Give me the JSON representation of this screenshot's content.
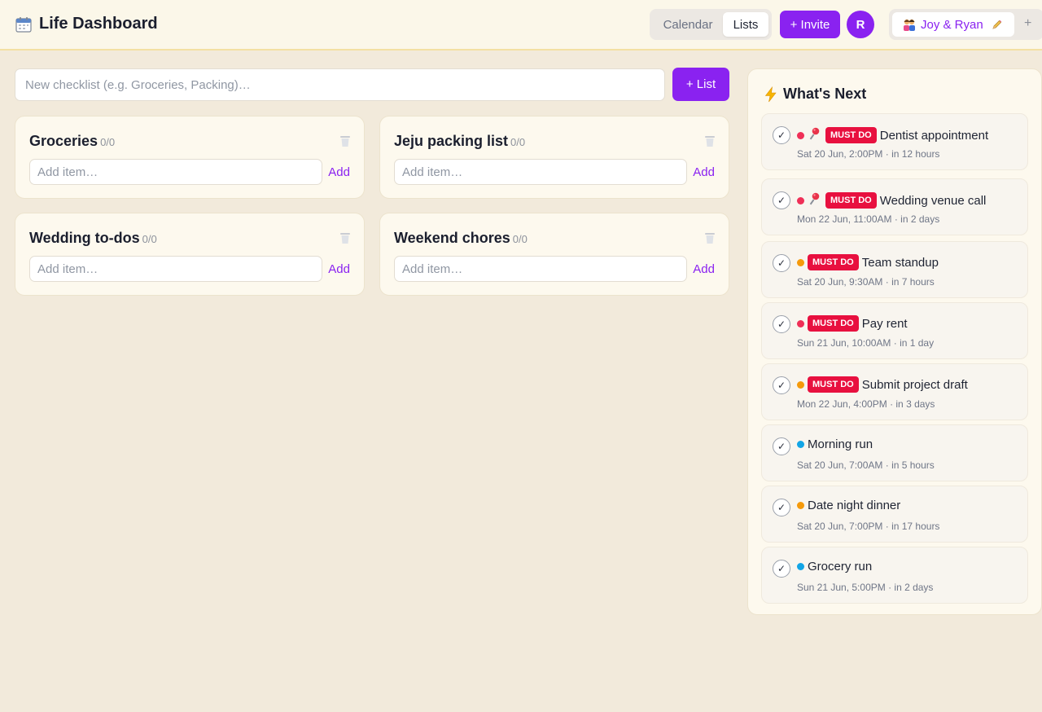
{
  "header": {
    "title": "Life Dashboard",
    "tabs": [
      {
        "label": "Calendar"
      },
      {
        "label": "Lists"
      }
    ],
    "invite_label": "+ Invite",
    "avatar_initial": "R",
    "space_name": "Joy & Ryan",
    "space_add": "+"
  },
  "new_checklist": {
    "placeholder": "New checklist (e.g. Groceries, Packing)…",
    "button_label": "+ List"
  },
  "lists": [
    {
      "title": "Groceries",
      "count": "0/0",
      "item_placeholder": "Add item…",
      "add_label": "Add"
    },
    {
      "title": "Jeju packing list",
      "count": "0/0",
      "item_placeholder": "Add item…",
      "add_label": "Add"
    },
    {
      "title": "Wedding to-dos",
      "count": "0/0",
      "item_placeholder": "Add item…",
      "add_label": "Add"
    },
    {
      "title": "Weekend chores",
      "count": "0/0",
      "item_placeholder": "Add item…",
      "add_label": "Add"
    }
  ],
  "whats_next": {
    "title": "What's Next",
    "badge_label": "MUST DO",
    "events": [
      {
        "title": "Dentist appointment",
        "meta": "Sat 20 Jun, 2:00PM · in 12 hours",
        "dot_color": "#ef2f57",
        "pinned": true,
        "must_do": true
      },
      {
        "title": "Wedding venue call",
        "meta": "Mon 22 Jun, 11:00AM · in 2 days",
        "dot_color": "#ef2f57",
        "pinned": true,
        "must_do": true
      },
      {
        "title": "Team standup",
        "meta": "Sat 20 Jun, 9:30AM · in 7 hours",
        "dot_color": "#f59a0b",
        "pinned": false,
        "must_do": true
      },
      {
        "title": "Pay rent",
        "meta": "Sun 21 Jun, 10:00AM · in 1 day",
        "dot_color": "#ef2f57",
        "pinned": false,
        "must_do": true
      },
      {
        "title": "Submit project draft",
        "meta": "Mon 22 Jun, 4:00PM · in 3 days",
        "dot_color": "#f59a0b",
        "pinned": false,
        "must_do": true
      },
      {
        "title": "Morning run",
        "meta": "Sat 20 Jun, 7:00AM · in 5 hours",
        "dot_color": "#12a5e6",
        "pinned": false,
        "must_do": false
      },
      {
        "title": "Date night dinner",
        "meta": "Sat 20 Jun, 7:00PM · in 17 hours",
        "dot_color": "#f59a0b",
        "pinned": false,
        "must_do": false
      },
      {
        "title": "Grocery run",
        "meta": "Sun 21 Jun, 5:00PM · in 2 days",
        "dot_color": "#12a5e6",
        "pinned": false,
        "must_do": false
      }
    ]
  },
  "colors": {
    "accent": "#8a22f0",
    "must_do": "#e8103f",
    "background": "#f2eadb"
  }
}
